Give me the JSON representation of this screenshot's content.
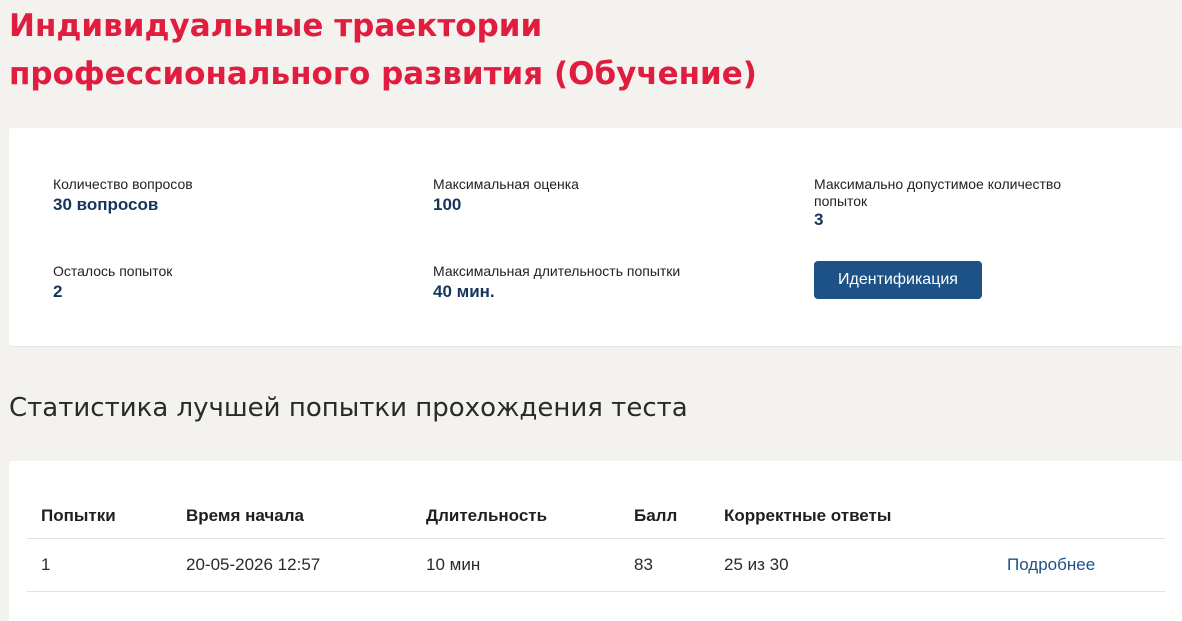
{
  "page": {
    "title_line1": "Индивидуальные траектории",
    "title_line2": "профессионального развития (Обучение)"
  },
  "info": {
    "questions": {
      "label": "Количество вопросов",
      "value": "30 вопросов"
    },
    "max_score": {
      "label": "Максимальная оценка",
      "value": "100"
    },
    "max_attempts": {
      "label": "Максимально допустимое количество попыток",
      "value": "3"
    },
    "remaining": {
      "label": "Осталось попыток",
      "value": "2"
    },
    "max_duration": {
      "label": "Максимальная длительность попытки",
      "value": "40 мин."
    },
    "identify_button": "Идентификация"
  },
  "stats": {
    "title": "Статистика лучшей попытки прохождения теста",
    "columns": [
      "Попытки",
      "Время начала",
      "Длительность",
      "Балл",
      "Корректные ответы",
      ""
    ],
    "rows": [
      {
        "attempt": "1",
        "start": "20-05-2026 12:57",
        "duration": "10 мин",
        "score": "83",
        "correct": "25 из 30",
        "details": "Подробнее"
      }
    ]
  },
  "colors": {
    "title": "#e11d3f",
    "value": "#16355e",
    "button": "#1d5286",
    "background": "#f3f2ef"
  }
}
